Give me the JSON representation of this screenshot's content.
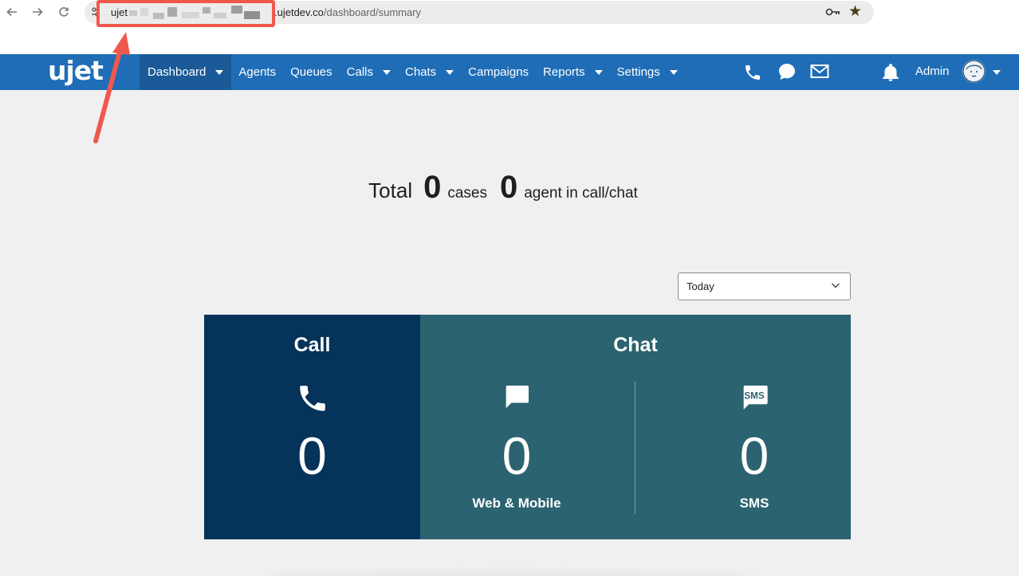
{
  "browser": {
    "url_prefix": "ujet",
    "url_domain": ".ujetdev.co",
    "url_path": "/dashboard/summary"
  },
  "header": {
    "logo": "ujet",
    "nav": [
      {
        "label": "Dashboard"
      },
      {
        "label": "Agents"
      },
      {
        "label": "Queues"
      },
      {
        "label": "Calls"
      },
      {
        "label": "Chats"
      },
      {
        "label": "Campaigns"
      },
      {
        "label": "Reports"
      },
      {
        "label": "Settings"
      }
    ],
    "user_label": "Admin"
  },
  "summary": {
    "total_word": "Total",
    "cases_count": "0",
    "cases_word": "cases",
    "agent_count": "0",
    "agent_word": "agent in call/chat"
  },
  "filter": {
    "selected": "Today"
  },
  "cards": {
    "call": {
      "title": "Call",
      "value": "0"
    },
    "chat": {
      "title": "Chat",
      "web": {
        "value": "0",
        "label": "Web & Mobile"
      },
      "sms": {
        "value": "0",
        "label": "SMS",
        "icon_text": "SMS"
      }
    }
  },
  "colors": {
    "header_bg": "#1f6db6",
    "call_card": "#06335a",
    "chat_card": "#2b6370",
    "annotation": "#f0584c"
  },
  "icons": [
    "back-icon",
    "forward-icon",
    "reload-icon",
    "site-info-icon",
    "key-icon",
    "star-icon",
    "phone-icon",
    "chat-bubble-icon",
    "mail-icon",
    "bell-icon",
    "avatar",
    "sms-icon"
  ]
}
